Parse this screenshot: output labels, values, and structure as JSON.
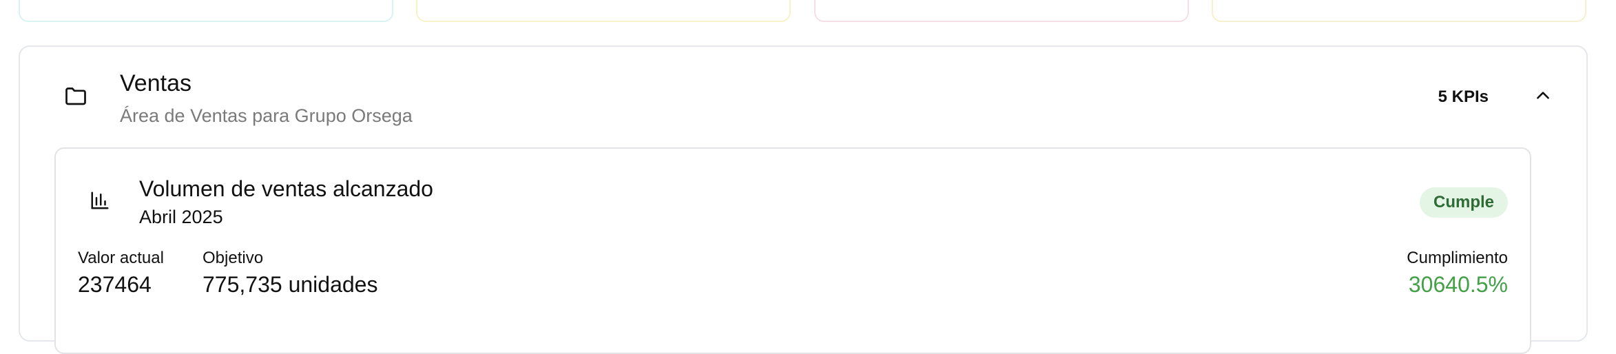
{
  "area": {
    "title": "Ventas",
    "subtitle": "Área de Ventas para Grupo Orsega",
    "kpi_count": "5 KPIs"
  },
  "kpi": {
    "title": "Volumen de ventas alcanzado",
    "period": "Abril 2025",
    "status": "Cumple",
    "actual_label": "Valor actual",
    "actual_value": "237464",
    "target_label": "Objetivo",
    "target_value": "775,735 unidades",
    "compliance_label": "Cumplimiento",
    "compliance_value": "30640.5%"
  },
  "colors": {
    "status_bg": "#e4f5e6",
    "status_text": "#2f6b37",
    "compliance_green": "#43a047",
    "card_border": "#e5e7eb",
    "subtitle_gray": "#7a7a7a"
  },
  "icons": {
    "area": "folder-icon",
    "collapse": "chevron-up-icon",
    "kpi": "bar-chart-icon"
  }
}
